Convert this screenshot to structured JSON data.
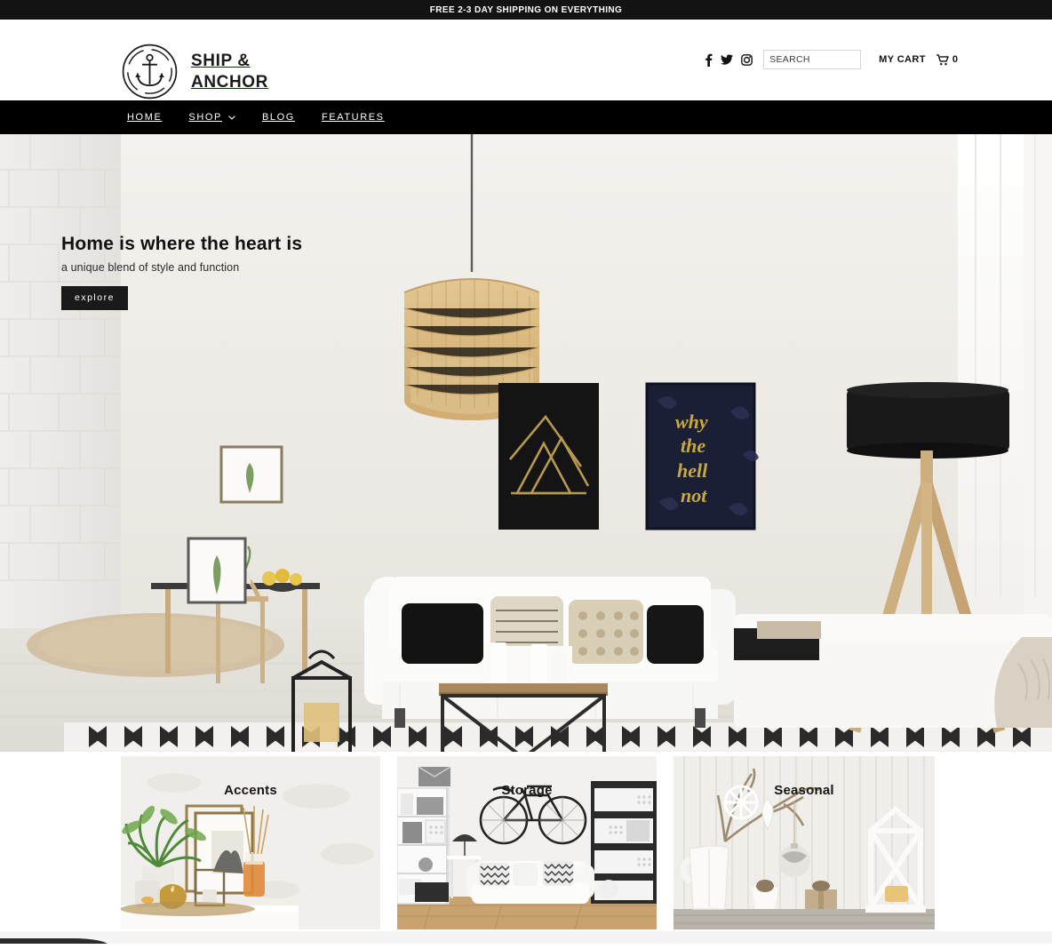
{
  "announcement": {
    "text": "FREE 2-3 DAY SHIPPING ON EVERYTHING"
  },
  "header": {
    "logo": {
      "icon": "anchor-in-circle-logo",
      "line1": "SHIP &",
      "line2": "ANCHOR"
    },
    "social": [
      {
        "name": "facebook-icon",
        "label": "f"
      },
      {
        "name": "twitter-icon",
        "label": "t"
      },
      {
        "name": "instagram-icon",
        "label": "ig"
      }
    ],
    "search": {
      "placeholder": "SEARCH",
      "value": ""
    },
    "cart": {
      "label": "MY CART",
      "icon": "shopping-cart-icon",
      "count": "0"
    }
  },
  "nav": {
    "items": [
      {
        "label": "HOME",
        "has_dropdown": false
      },
      {
        "label": "SHOP",
        "has_dropdown": true
      },
      {
        "label": "BLOG",
        "has_dropdown": false
      },
      {
        "label": "FEATURES",
        "has_dropdown": false
      }
    ]
  },
  "hero": {
    "title": "Home is where the heart is",
    "subtitle": "a unique blend of style and function",
    "button_label": "explore",
    "image_alt": "bright scandinavian living room with white sofa, rattan pendant lamp, tripod floor lamp and wall art"
  },
  "collections": {
    "cards": [
      {
        "title": "Accents",
        "image_alt": "plants, picture frames, reed diffuser and candles on a white shelf"
      },
      {
        "title": "Storage",
        "image_alt": "white sofa with bicycle on wall between white and black shelving units"
      },
      {
        "title": "Seasonal",
        "image_alt": "white pitcher with branches, snowflake ornaments and white wooden lantern"
      }
    ]
  },
  "colors": {
    "accent": "#000000",
    "announce_bg": "#131313",
    "nav_bg": "#000000",
    "text": "#111111",
    "page_bg": "#ffffff"
  }
}
